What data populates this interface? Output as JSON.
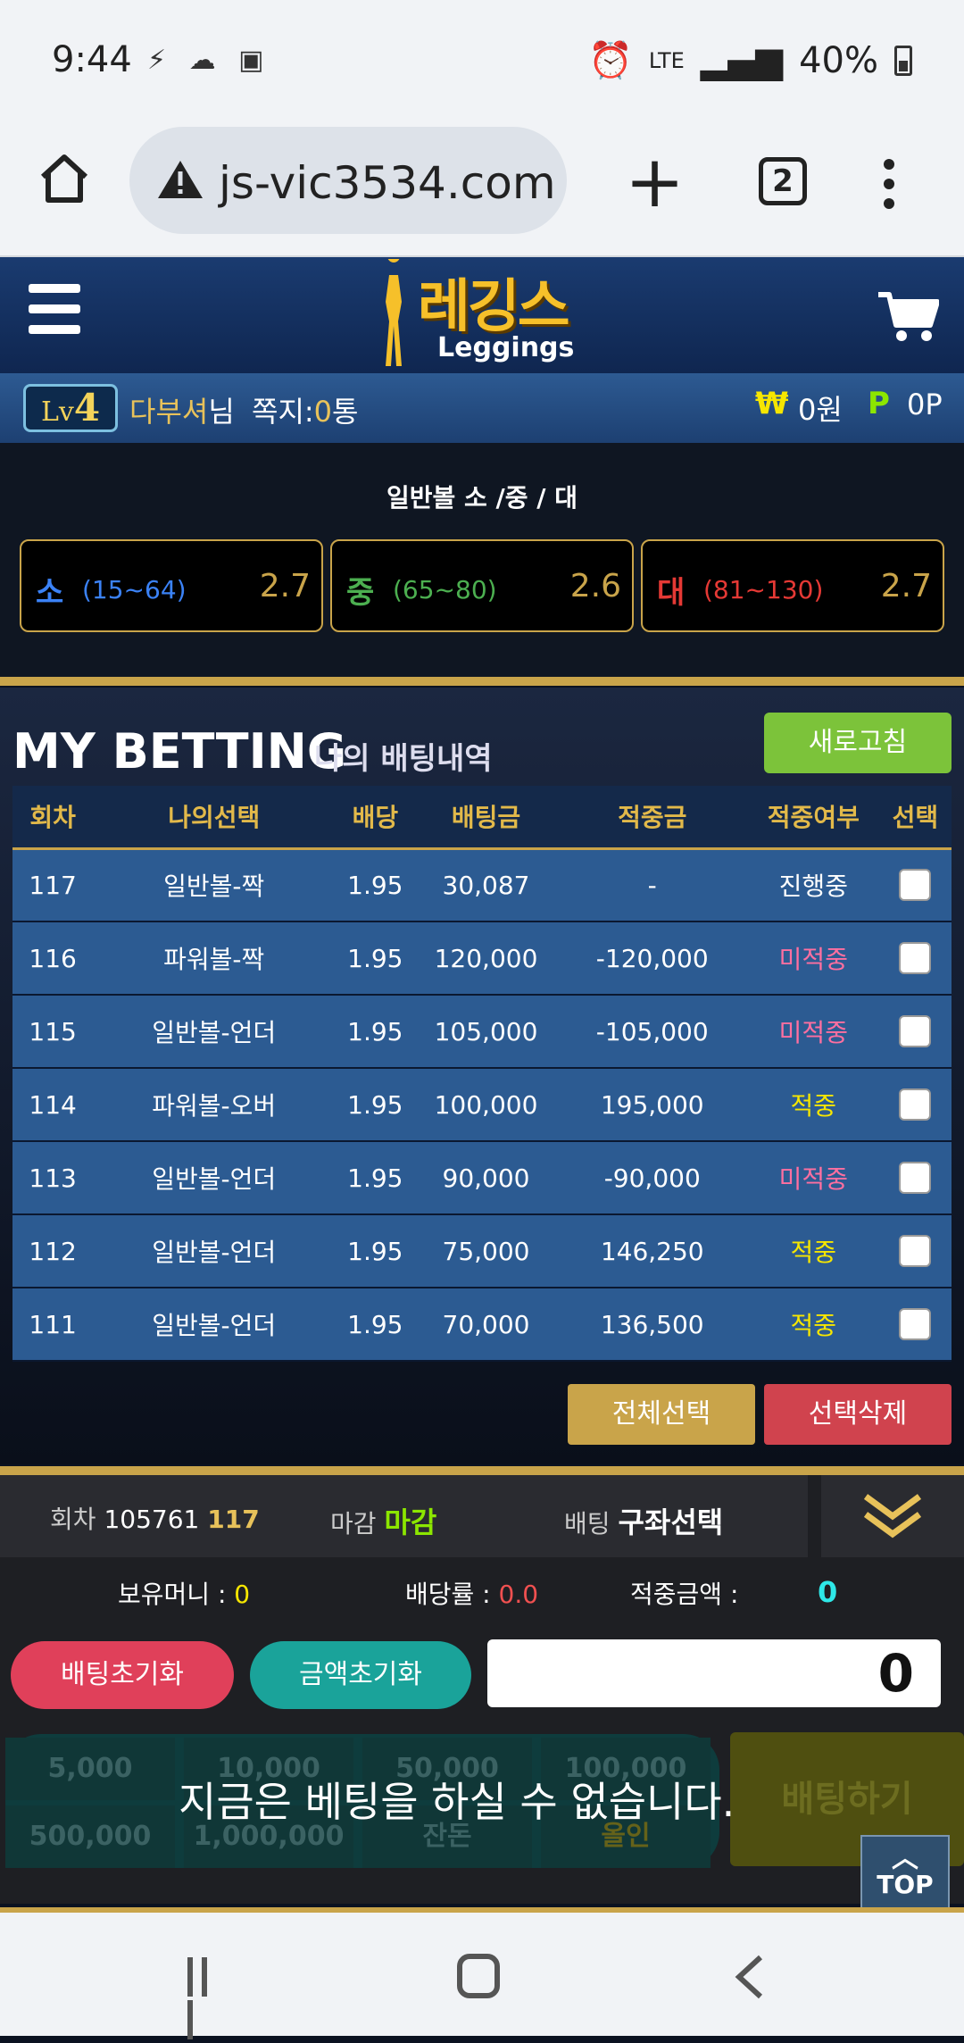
{
  "status_bar": {
    "time": "9:44",
    "icons_left": "⚡ ☁ ▣",
    "network": "LTE",
    "battery": "40%"
  },
  "browser": {
    "url": "js-vic3534.com",
    "tab_count": "2"
  },
  "header": {
    "logo_korean": "레깅스",
    "logo_english": "Leggings"
  },
  "user_bar": {
    "level_prefix": "Lv",
    "level_num": "4",
    "username": "다부셔",
    "username_suffix": "님",
    "message_label": "쪽지:",
    "message_count": "0",
    "message_unit": "통",
    "currency_symbol": "₩",
    "money": "0원",
    "points_symbol": "P",
    "points": "0P"
  },
  "ball_options": {
    "title": "일반볼 소 /중 / 대",
    "items": [
      {
        "name": "소",
        "range": "(15~64)",
        "odds": "2.7",
        "color": "#3b82f6"
      },
      {
        "name": "중",
        "range": "(65~80)",
        "odds": "2.6",
        "color": "#4caf50"
      },
      {
        "name": "대",
        "range": "(81~130)",
        "odds": "2.7",
        "color": "#e53935"
      }
    ]
  },
  "my_betting": {
    "title": "MY BETTING",
    "subtitle": "나의 배팅내역",
    "refresh_label": "새로고침",
    "headers": [
      "회차",
      "나의선택",
      "배당",
      "배팅금",
      "적중금",
      "적중여부",
      "선택"
    ],
    "rows": [
      {
        "round": "117",
        "choice": "일반볼-짝",
        "odds": "1.95",
        "bet": "30,087",
        "win": "-",
        "result": "진행중",
        "result_color": "#ffffff"
      },
      {
        "round": "116",
        "choice": "파워볼-짝",
        "odds": "1.95",
        "bet": "120,000",
        "win": "-120,000",
        "result": "미적중",
        "result_color": "#ff6fa0"
      },
      {
        "round": "115",
        "choice": "일반볼-언더",
        "odds": "1.95",
        "bet": "105,000",
        "win": "-105,000",
        "result": "미적중",
        "result_color": "#ff6fa0"
      },
      {
        "round": "114",
        "choice": "파워볼-오버",
        "odds": "1.95",
        "bet": "100,000",
        "win": "195,000",
        "result": "적중",
        "result_color": "#f6e600"
      },
      {
        "round": "113",
        "choice": "일반볼-언더",
        "odds": "1.95",
        "bet": "90,000",
        "win": "-90,000",
        "result": "미적중",
        "result_color": "#ff6fa0"
      },
      {
        "round": "112",
        "choice": "일반볼-언더",
        "odds": "1.95",
        "bet": "75,000",
        "win": "146,250",
        "result": "적중",
        "result_color": "#f6e600"
      },
      {
        "round": "111",
        "choice": "일반볼-언더",
        "odds": "1.95",
        "bet": "70,000",
        "win": "136,500",
        "result": "적중",
        "result_color": "#f6e600"
      }
    ],
    "select_all_label": "전체선택",
    "delete_selected_label": "선택삭제"
  },
  "bet_panel": {
    "round_label": "회차",
    "round_value": "105761",
    "round_sub": "117",
    "deadline_label": "마감",
    "deadline_value": "마감",
    "betting_label": "배팅",
    "betting_value": "구좌선택",
    "balance_label": "보유머니 :",
    "balance_value": "0",
    "odds_label": "배당률 :",
    "odds_value": "0.0",
    "win_label": "적중금액 :",
    "win_value": "0",
    "reset_bet_label": "배팅초기화",
    "reset_amount_label": "금액초기화",
    "amount_value": "0",
    "chips": [
      "5,000",
      "10,000",
      "50,000",
      "100,000",
      "500,000",
      "1,000,000",
      "잔돈",
      "올인"
    ],
    "bet_now_label": "배팅하기",
    "overlay_message": "지금은 베팅을 하실 수 없습니다.",
    "top_label": "TOP"
  }
}
